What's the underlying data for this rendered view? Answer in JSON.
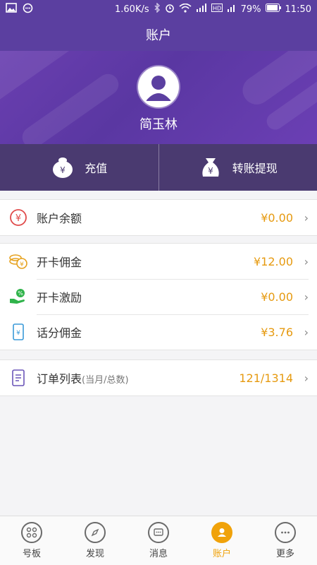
{
  "status_bar": {
    "speed": "1.60K/s",
    "battery": "79%",
    "time": "11:50",
    "icons": [
      "image-icon",
      "chat-icon",
      "bluetooth-icon",
      "alarm-icon",
      "wifi-icon",
      "signal-icon",
      "hd-icon",
      "signal2-icon",
      "battery-icon"
    ]
  },
  "header": {
    "title": "账户"
  },
  "profile": {
    "name": "简玉林",
    "avatar_icon": "user-avatar-icon"
  },
  "actions": [
    {
      "label": "充值",
      "icon": "money-bag-icon"
    },
    {
      "label": "转账提现",
      "icon": "money-sack-icon"
    }
  ],
  "balance": {
    "label": "账户余额",
    "value": "¥0.00",
    "icon": "yen-circle-icon",
    "color": "#e04a4a"
  },
  "commissions": [
    {
      "label": "开卡佣金",
      "value": "¥12.00",
      "icon": "coins-icon",
      "color": "#e6a11c"
    },
    {
      "label": "开卡激励",
      "value": "¥0.00",
      "icon": "hand-percent-icon",
      "color": "#2fb34a"
    },
    {
      "label": "话分佣金",
      "value": "¥3.76",
      "icon": "phone-yen-icon",
      "color": "#3a9ad9"
    }
  ],
  "orders": {
    "label": "订单列表",
    "sub": "(当月/总数)",
    "value": "121/1314",
    "icon": "document-list-icon",
    "color": "#6a55b8"
  },
  "tabs": [
    {
      "label": "号板",
      "icon": "grid-icon",
      "active": false
    },
    {
      "label": "发现",
      "icon": "compass-icon",
      "active": false
    },
    {
      "label": "消息",
      "icon": "message-icon",
      "active": false
    },
    {
      "label": "账户",
      "icon": "account-icon",
      "active": true
    },
    {
      "label": "更多",
      "icon": "more-icon",
      "active": false
    }
  ],
  "colors": {
    "brand": "#5b3fa0",
    "accent": "#f0a20a",
    "value": "#e69a10"
  }
}
